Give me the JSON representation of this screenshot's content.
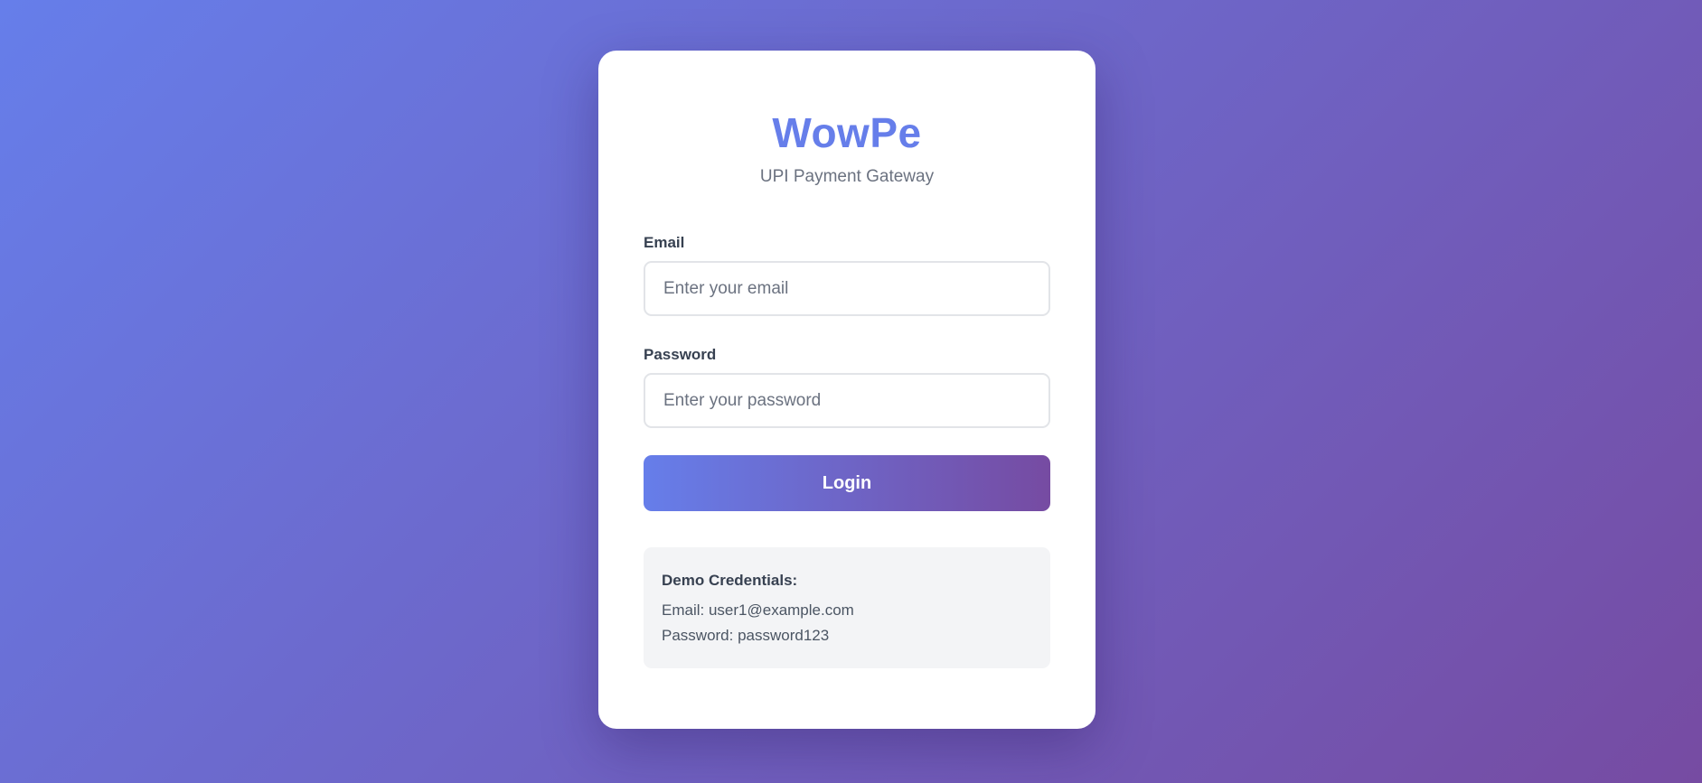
{
  "brand": {
    "name": "WowPe",
    "subtitle": "UPI Payment Gateway"
  },
  "form": {
    "email": {
      "label": "Email",
      "placeholder": "Enter your email",
      "value": ""
    },
    "password": {
      "label": "Password",
      "placeholder": "Enter your password",
      "value": ""
    },
    "submit_label": "Login"
  },
  "demo": {
    "title": "Demo Credentials:",
    "email_line": "Email: user1@example.com",
    "password_line": "Password: password123"
  },
  "colors": {
    "background_gradient_start": "#667eea",
    "background_gradient_end": "#764ba2",
    "brand": "#667eea",
    "card": "#ffffff",
    "demo_box": "#f3f4f6"
  }
}
